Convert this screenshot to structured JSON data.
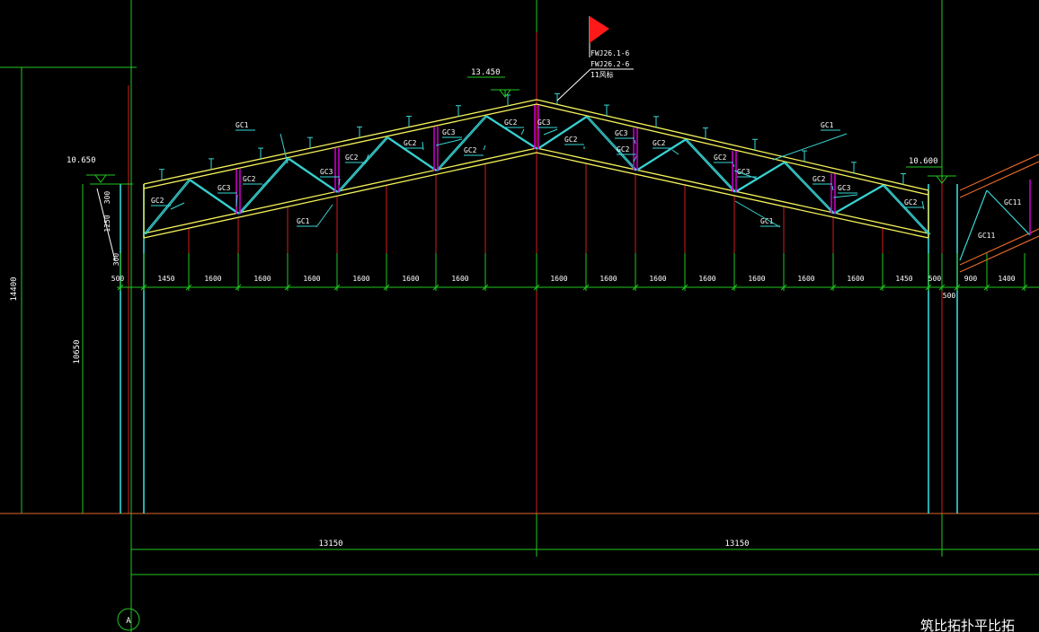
{
  "colors": {
    "background": "#000000",
    "chord": "#f4f25a",
    "web": "#39d6d6",
    "post": "#d200d2",
    "column": "#35e6e6",
    "grid_red": "#d21c1c",
    "grid_green": "#22c722",
    "ground": "#e0662a",
    "text": "#ffffff",
    "flag": "#ff1a1a"
  },
  "elevations": {
    "ridge": "13.450",
    "left_eave": "10.650",
    "right_eave": "10.600"
  },
  "flag_labels": [
    "FWJ26.1-6",
    "FWJ26.2-6",
    "11风标"
  ],
  "member_labels": [
    "GC1",
    "GC2",
    "GC3"
  ],
  "left_depth_dims": [
    "300",
    "1250",
    "300"
  ],
  "bottom_dims_left": [
    "500",
    "1450",
    "1600",
    "1600",
    "1600",
    "1600",
    "1600",
    "1600"
  ],
  "bottom_dims_right": [
    "1600",
    "1600",
    "1600",
    "1600",
    "1600",
    "1600",
    "1600",
    "1450",
    "500"
  ],
  "bottom_dims_far": [
    "900",
    "1400"
  ],
  "sub_dim": "500",
  "height_total": "14400",
  "height_column": "10650",
  "span_dims": [
    "13150",
    "13150"
  ],
  "grid_axis": "A",
  "far_labels": [
    "GC11",
    "GC11"
  ],
  "corner_text": "筑比拓扑平比拓"
}
